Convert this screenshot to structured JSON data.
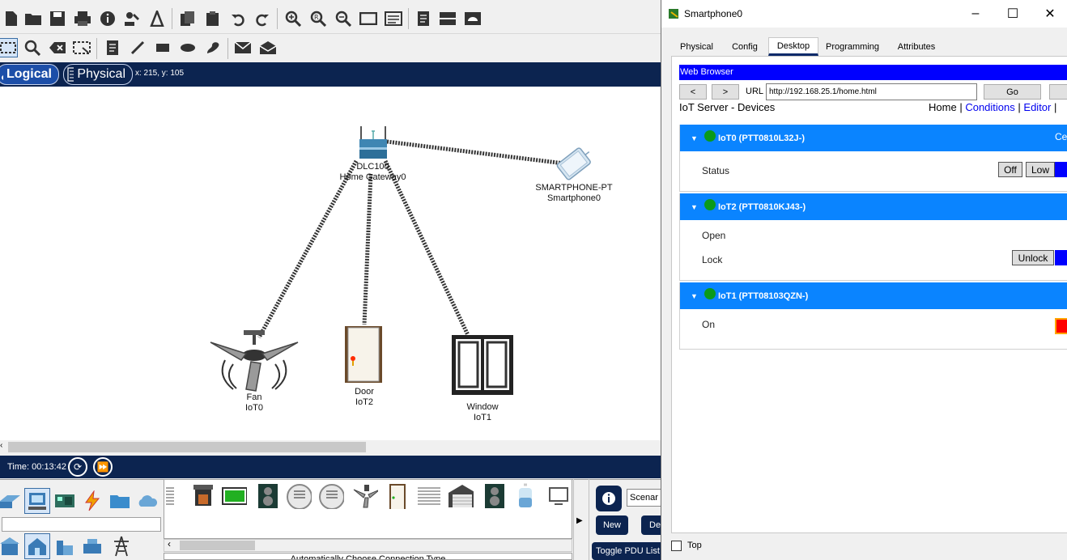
{
  "main": {
    "mode_logical": "Logical",
    "mode_physical": "Physical",
    "coords": "x: 215, y: 105",
    "time_label": "Time: 00:13:42",
    "devices": [
      {
        "line1": "DLC100",
        "line2": "Home Gateway0"
      },
      {
        "line1": "SMARTPHONE-PT",
        "line2": "Smartphone0"
      },
      {
        "line1": "Fan",
        "line2": "IoT0"
      },
      {
        "line1": "Door",
        "line2": "IoT2"
      },
      {
        "line1": "Window",
        "line2": "IoT1"
      }
    ],
    "bottom": {
      "auto_connection": "Automatically Choose Connection Type",
      "scenario_value": "Scenar",
      "new_button": "New",
      "delete_button": "De",
      "toggle_pdu": "Toggle PDU List W"
    }
  },
  "phone": {
    "title": "Smartphone0",
    "tabs": [
      "Physical",
      "Config",
      "Desktop",
      "Programming",
      "Attributes"
    ],
    "active_tab": "Desktop",
    "browser_title": "Web Browser",
    "back_btn": "<",
    "fwd_btn": ">",
    "url_label": "URL",
    "url_value": "http://192.168.25.1/home.html",
    "go_btn": "Go",
    "page_header": "IoT Server - Devices",
    "nav": {
      "home": "Home",
      "sep1": "|",
      "conditions": "Conditions",
      "sep2": "|",
      "editor": "Editor",
      "sep3": "|"
    },
    "devices": [
      {
        "name": "IoT0 (PTT0810L32J-)",
        "extra": "Ce",
        "fields": [
          {
            "label": "Status",
            "buttons": [
              "Off",
              "Low"
            ]
          }
        ]
      },
      {
        "name": "IoT2 (PTT0810KJ43-)",
        "fields": [
          {
            "label": "Open"
          },
          {
            "label": "Lock",
            "buttons": [
              "Unlock"
            ]
          }
        ]
      },
      {
        "name": "IoT1 (PTT08103QZN-)",
        "fields": [
          {
            "label": "On"
          }
        ]
      }
    ],
    "top_label": "Top"
  },
  "colors": {
    "navy": "#0c2450",
    "device_header": "#0a84ff",
    "browser_bar": "#0000ff",
    "status_green": "#0a9a1a",
    "indicator_red": "#ff0000"
  }
}
